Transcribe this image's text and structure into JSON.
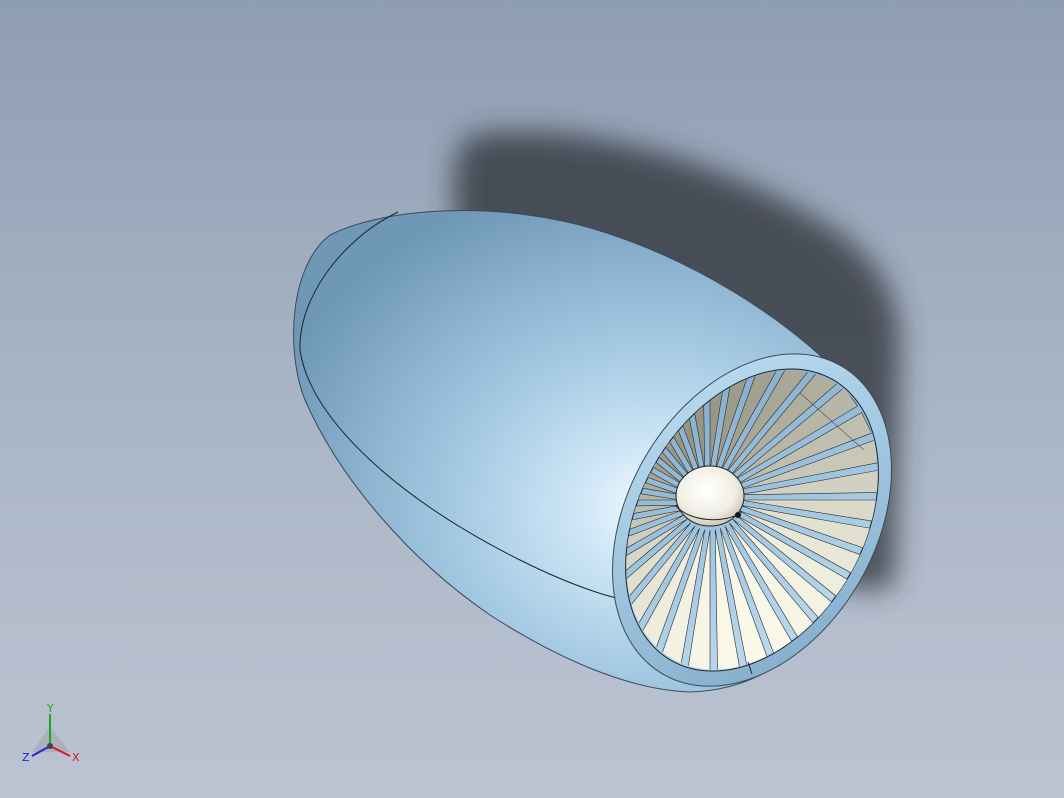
{
  "view": {
    "background_top": "#8e9db3",
    "background_bottom": "#bcc4d2",
    "model": {
      "part": "turbofan-engine-nacelle",
      "nacelle_color": "#a9cde8",
      "blade_color": "#e9e7d6",
      "spinner_color": "#ffffff",
      "blade_count": 36
    }
  },
  "triad": {
    "x_label": "X",
    "y_label": "Y",
    "z_label": "Z",
    "x_color": "#e0141e",
    "y_color": "#1aa81a",
    "z_color": "#1a2ad8"
  }
}
